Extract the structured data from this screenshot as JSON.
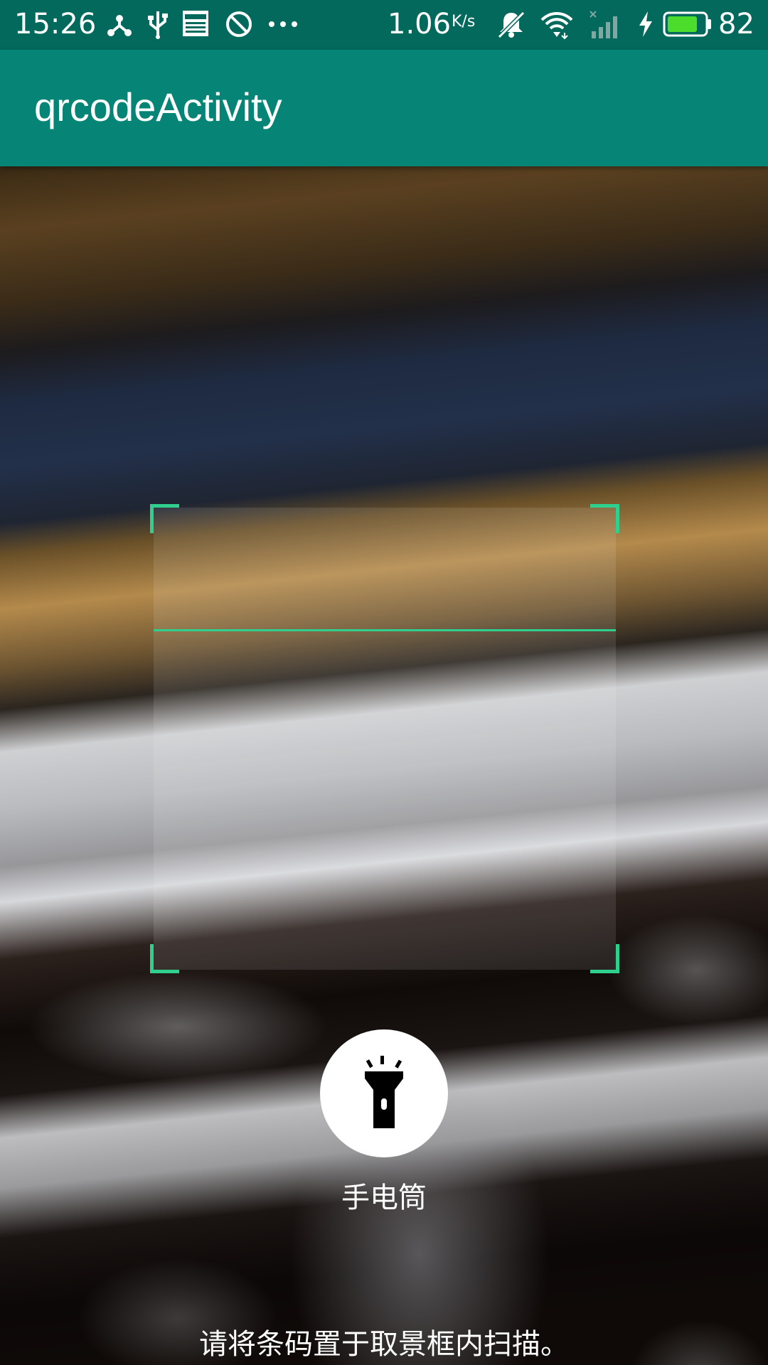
{
  "status_bar": {
    "time": "15:26",
    "network_speed": "1.06",
    "network_speed_unit": "K/s",
    "battery_percent": "82",
    "icons": [
      "usb-tether-icon",
      "usb-icon",
      "news-icon",
      "dnd-icon",
      "more-dots-icon",
      "mute-icon",
      "wifi-icon",
      "signal-no-sim-icon",
      "charging-icon",
      "battery-icon"
    ],
    "battery_level": 0.82,
    "battery_color": "#4cdc2c"
  },
  "app_bar": {
    "title": "qrcodeActivity",
    "color": "#068576"
  },
  "scanner": {
    "accent_color": "#2fcf8e"
  },
  "flashlight": {
    "icon": "flashlight-icon",
    "label": "手电筒"
  },
  "hint": {
    "text": "请将条码置于取景框内扫描。"
  }
}
